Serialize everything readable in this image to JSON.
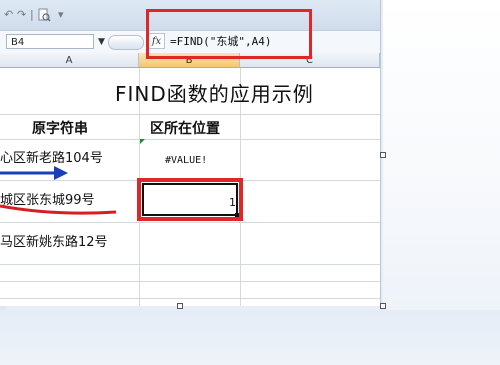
{
  "name_box": {
    "value": "B4"
  },
  "formula_bar": {
    "fx_label": "fx",
    "formula": "=FIND(\"东城\",A4)"
  },
  "columns": [
    "A",
    "B",
    "C"
  ],
  "sheet": {
    "title": "FIND函数的应用示例",
    "header_a": "原字符串",
    "header_b": "区所在位置",
    "rows": [
      {
        "a": "心区新老路104号",
        "b": "#VALUE!"
      },
      {
        "a": "城区张东城99号",
        "b": "1"
      },
      {
        "a": "马区新姚东路12号",
        "b": ""
      }
    ]
  },
  "annotations": {
    "arrow_color": "#1a3fb8",
    "highlight_color": "#e02727",
    "underline_color": "#d42020"
  }
}
